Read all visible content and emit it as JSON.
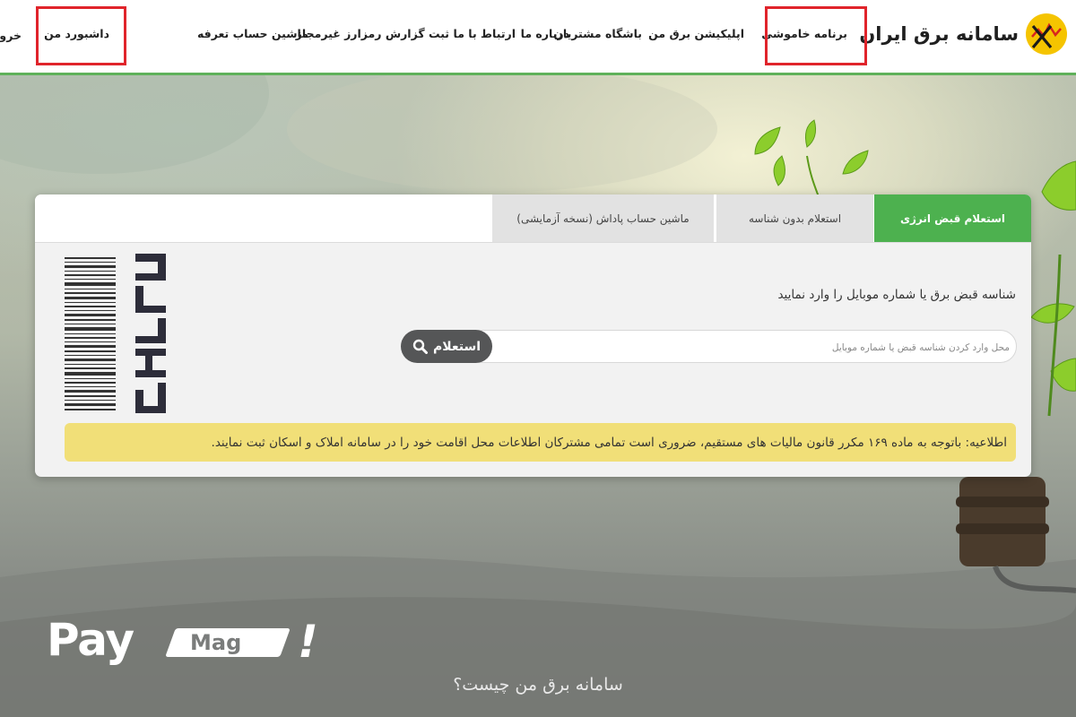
{
  "header": {
    "brand": "سامانه برق ایران",
    "nav": [
      {
        "id": "blackout",
        "label": "برنامه خاموشی"
      },
      {
        "id": "app",
        "label": "اپلیکیشن برق من"
      },
      {
        "id": "club",
        "label": "باشگاه مشتریان"
      },
      {
        "id": "about",
        "label": "درباره ما"
      },
      {
        "id": "contact",
        "label": "ارتباط با ما"
      },
      {
        "id": "crypto",
        "label": "ثبت گزارش رمزارز غیرمجاز"
      },
      {
        "id": "tariff",
        "label": "ماشین حساب تعرفه"
      }
    ],
    "dashboard": "داشبورد من",
    "logout": "خروج"
  },
  "tabs": [
    {
      "label": "استعلام قبض انرژی",
      "active": true
    },
    {
      "label": "استعلام بدون شناسه",
      "active": false
    },
    {
      "label": "ماشین حساب پاداش (نسخه آزمایشی)",
      "active": false
    }
  ],
  "form": {
    "prompt": "شناسه قبض برق یا شماره موبایل را وارد نمایید",
    "placeholder": "محل وارد کردن شناسه قبض یا شماره موبایل",
    "button": "استعلام"
  },
  "notice": "اطلاعیه: باتوجه به ماده ۱۶۹ مکرر قانون مالیات های مستقیم، ضروری است تمامی مشترکان اطلاعات محل اقامت خود را در سامانه املاک و اسکان ثبت نمایند.",
  "bill_logo": "قبض برق",
  "watermark": {
    "pay": "Pay",
    "mag": "Mag",
    "bang": "!"
  },
  "section_title": "سامانه برق من چیست؟",
  "colors": {
    "accent_green": "#4db14f",
    "highlight_red": "#e0242b",
    "notice_yellow": "#f1df78",
    "logo_yellow": "#f5c400"
  }
}
